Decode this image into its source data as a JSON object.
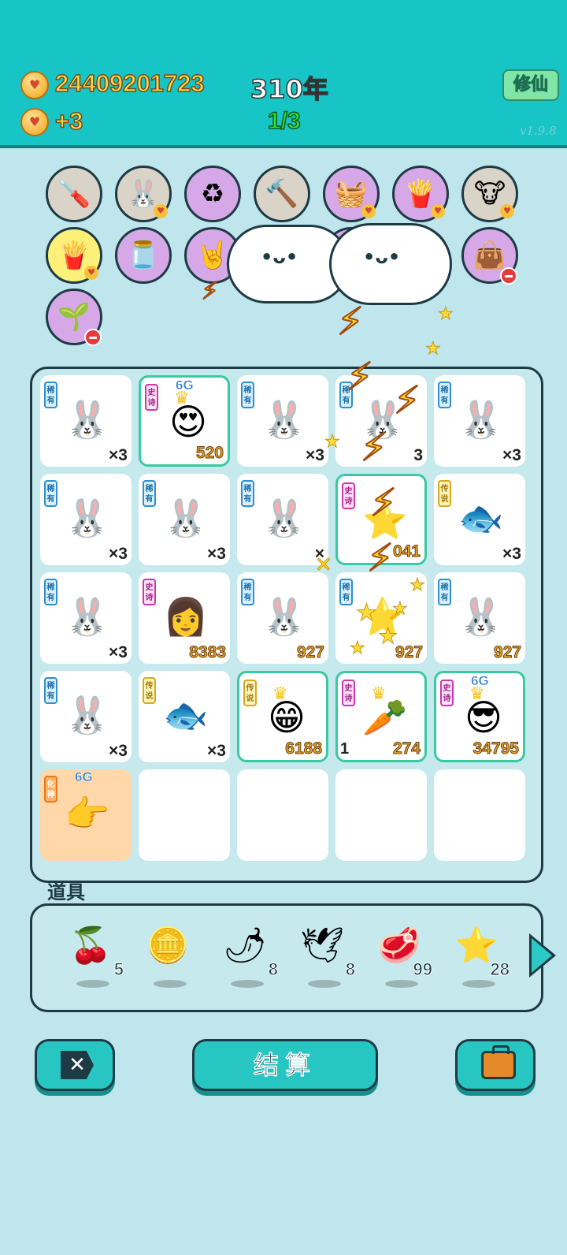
{
  "header": {
    "coins": "24409201723",
    "year": "310年",
    "income": "+3",
    "stage": "1/3",
    "mode_button": "修仙",
    "version": "v1.9.8"
  },
  "shelf": [
    {
      "icon": "🪛",
      "color": "gray"
    },
    {
      "icon": "🐰",
      "color": "gray",
      "heart": true
    },
    {
      "icon": "♻",
      "color": "purple"
    },
    {
      "icon": "🔨",
      "color": "gray"
    },
    {
      "icon": "🧺",
      "color": "purple",
      "heart": true
    },
    {
      "icon": "🍟",
      "color": "purple",
      "heart": true
    },
    {
      "icon": "🐮",
      "color": "gray",
      "heart": true
    },
    {
      "icon": "🍟",
      "color": "yellow",
      "heart": true
    },
    {
      "icon": "🫙",
      "color": "purple"
    },
    {
      "icon": "🤘",
      "color": "purple"
    },
    {
      "icon": "🍈",
      "color": "purple"
    },
    {
      "icon": "🫖",
      "color": "purple"
    },
    {
      "icon": "👜",
      "color": "purple",
      "minus": true
    },
    {
      "icon": "👜",
      "color": "purple",
      "minus": true
    },
    {
      "icon": "🌱",
      "color": "purple",
      "minus": true
    }
  ],
  "board": [
    {
      "tag": "稀有",
      "tag_type": "rare",
      "art": "🐰",
      "count": "×3"
    },
    {
      "tag": "史诗",
      "tag_type": "epic",
      "art": "😍",
      "count": "520",
      "gold": true,
      "badge": "6G",
      "crown": true,
      "frame": "epic"
    },
    {
      "tag": "稀有",
      "tag_type": "rare",
      "art": "🐰",
      "count": "×3"
    },
    {
      "tag": "稀有",
      "tag_type": "rare",
      "art": "🐰",
      "count": "3"
    },
    {
      "tag": "稀有",
      "tag_type": "rare",
      "art": "🐰",
      "count": "×3"
    },
    {
      "tag": "稀有",
      "tag_type": "rare",
      "art": "🐰",
      "count": "×3"
    },
    {
      "tag": "稀有",
      "tag_type": "rare",
      "art": "🐰",
      "count": "×3"
    },
    {
      "tag": "稀有",
      "tag_type": "rare",
      "art": "🐰",
      "count": "×"
    },
    {
      "tag": "史诗",
      "tag_type": "epic",
      "art": "⭐",
      "count": "041",
      "gold": true,
      "frame": "epic"
    },
    {
      "tag": "传说",
      "tag_type": "legend",
      "art": "🐟",
      "count": "×3"
    },
    {
      "tag": "稀有",
      "tag_type": "rare",
      "art": "🐰",
      "count": "×3"
    },
    {
      "tag": "史诗",
      "tag_type": "epic",
      "art": "👩",
      "count": "8383",
      "gold": true
    },
    {
      "tag": "稀有",
      "tag_type": "rare",
      "art": "🐰",
      "count": "927",
      "gold": true
    },
    {
      "tag": "稀有",
      "tag_type": "rare",
      "art": "⭐",
      "count": "927",
      "gold": true
    },
    {
      "tag": "稀有",
      "tag_type": "rare",
      "art": "🐰",
      "count": "927",
      "gold": true
    },
    {
      "tag": "稀有",
      "tag_type": "rare",
      "art": "🐰",
      "count": "×3"
    },
    {
      "tag": "传说",
      "tag_type": "legend",
      "art": "🐟",
      "count": "×3"
    },
    {
      "tag": "传说",
      "tag_type": "legend",
      "art": "😁",
      "count": "6188",
      "gold": true,
      "crown": true,
      "frame": "epic"
    },
    {
      "tag": "史诗",
      "tag_type": "epic",
      "art": "🥕",
      "count": "274",
      "gold": true,
      "level": "1",
      "crown": true,
      "frame": "epic"
    },
    {
      "tag": "史诗",
      "tag_type": "epic",
      "art": "😎",
      "count": "34795",
      "gold": true,
      "badge": "6G",
      "crown": true,
      "frame": "epic"
    },
    {
      "tag": "化神",
      "tag_type": "god",
      "art": "👉",
      "count": "",
      "badge": "6G",
      "frame": "orange"
    },
    {
      "empty": true
    },
    {
      "empty": true
    },
    {
      "empty": true
    },
    {
      "empty": true
    }
  ],
  "items_title": "道具",
  "items": [
    {
      "icon": "🍒",
      "count": "5"
    },
    {
      "icon": "🪙",
      "count": ""
    },
    {
      "icon": "🌶",
      "count": "8"
    },
    {
      "icon": "🕊",
      "count": "8"
    },
    {
      "icon": "🥩",
      "count": "99"
    },
    {
      "icon": "⭐",
      "count": "28"
    }
  ],
  "buttons": {
    "close": "✕",
    "settle": "结算"
  }
}
